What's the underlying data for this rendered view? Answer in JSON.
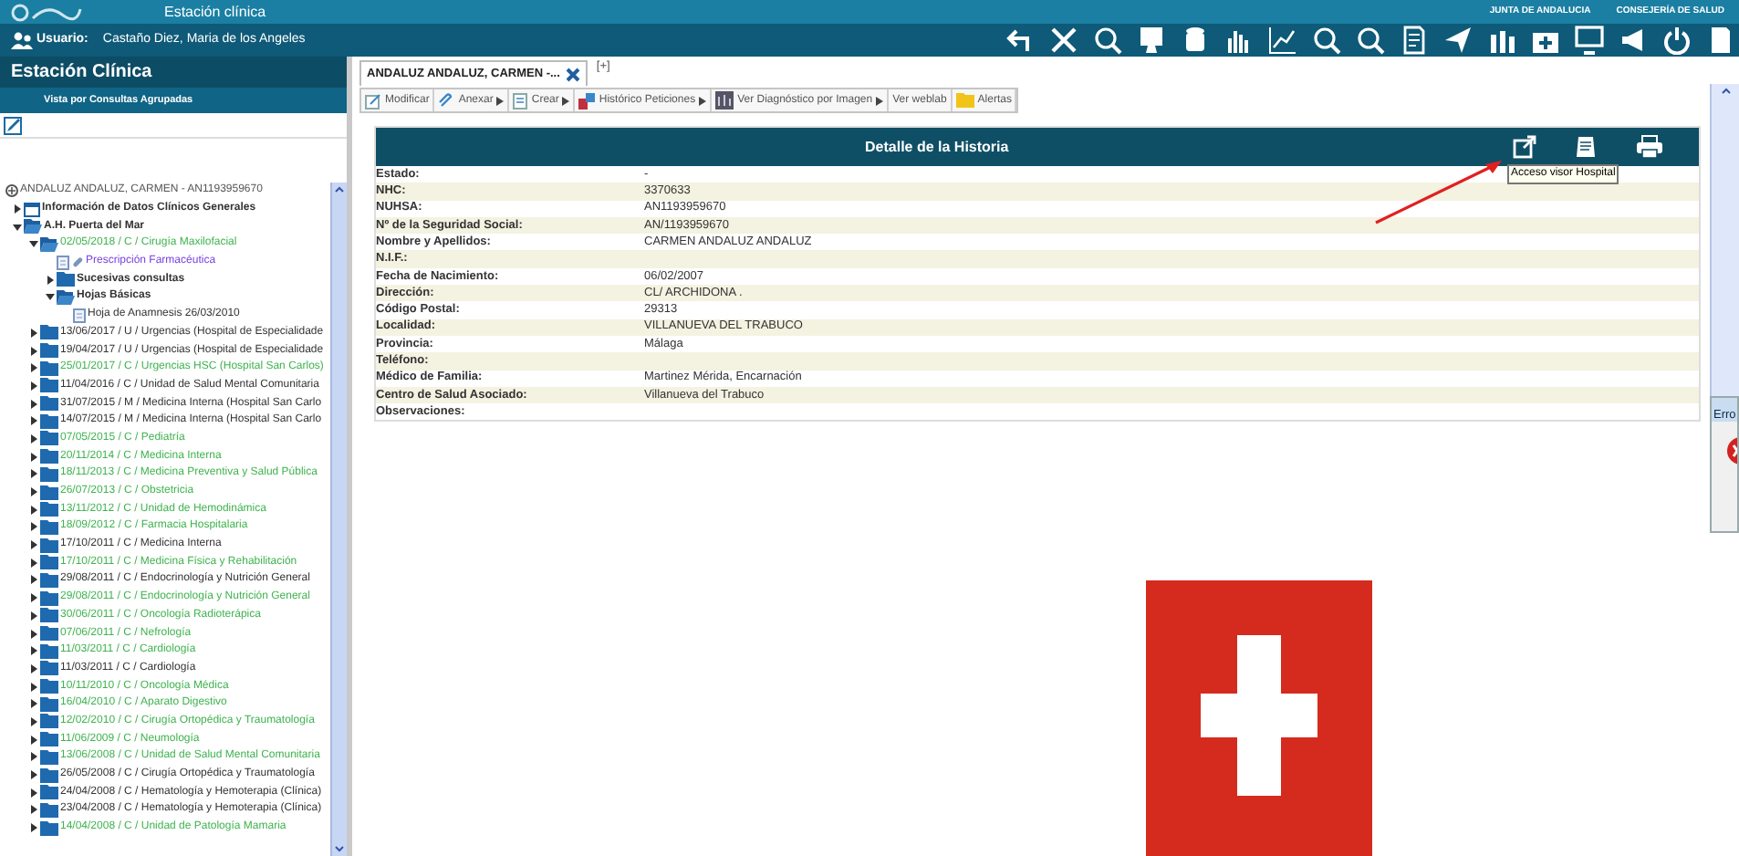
{
  "header": {
    "app_title": "Estación clínica",
    "user_label": "Usuario:",
    "user_name": "Castaño Diez, Maria de los Angeles",
    "org_top": "JUNTA DE ANDALUCIA",
    "org_bottom": "CONSEJERÍA DE SALUD"
  },
  "sidebar": {
    "title": "Estación Clínica",
    "view_label": "Vista por Consultas Agrupadas",
    "tree": {
      "label": "ANDALUZ ANDALUZ, CARMEN - AN1193959670",
      "kind": "patient",
      "children": [
        {
          "label": "Información de Datos Clínicos Generales",
          "kind": "info",
          "expanded": false
        },
        {
          "label": "A.H. Puerta del Mar",
          "kind": "group",
          "expanded": true,
          "children": [
            {
              "label": "02/05/2018 / C / Cirugía Maxilofacial",
              "kind": "visit",
              "color": "#3fb34f",
              "expanded": true,
              "children": [
                {
                  "label": "Prescripción Farmacéutica",
                  "kind": "prescription"
                },
                {
                  "label": "Sucesivas consultas",
                  "kind": "group",
                  "expanded": false
                },
                {
                  "label": "Hojas Básicas",
                  "kind": "group",
                  "expanded": true,
                  "children": [
                    {
                      "label": "Hoja de Anamnesis 26/03/2010",
                      "kind": "doc"
                    }
                  ]
                }
              ]
            },
            {
              "label": "13/06/2017 / U / Urgencias (Hospital de Especialidade",
              "kind": "visit",
              "color": "#333333",
              "expanded": false
            },
            {
              "label": "19/04/2017 / U / Urgencias (Hospital de Especialidade",
              "kind": "visit",
              "color": "#333333",
              "expanded": false
            },
            {
              "label": "25/01/2017 / C / Urgencias HSC (Hospital San Carlos)",
              "kind": "visit",
              "color": "#3fb34f",
              "expanded": false
            },
            {
              "label": "11/04/2016 / C / Unidad de Salud Mental Comunitaria",
              "kind": "visit",
              "color": "#333333",
              "expanded": false
            },
            {
              "label": "31/07/2015 / M / Medicina Interna (Hospital San Carlo",
              "kind": "visit",
              "color": "#333333",
              "expanded": false
            },
            {
              "label": "14/07/2015 / M / Medicina Interna (Hospital San Carlo",
              "kind": "visit",
              "color": "#333333",
              "expanded": false
            },
            {
              "label": "07/05/2015 / C / Pediatría",
              "kind": "visit",
              "color": "#3fb34f",
              "expanded": false
            },
            {
              "label": "20/11/2014 / C / Medicina Interna",
              "kind": "visit",
              "color": "#3fb34f",
              "expanded": false
            },
            {
              "label": "18/11/2013 / C / Medicina Preventiva y Salud Pública",
              "kind": "visit",
              "color": "#3fb34f",
              "expanded": false
            },
            {
              "label": "26/07/2013 / C / Obstetricia",
              "kind": "visit",
              "color": "#3fb34f",
              "expanded": false
            },
            {
              "label": "13/11/2012 / C / Unidad de Hemodinámica",
              "kind": "visit",
              "color": "#3fb34f",
              "expanded": false
            },
            {
              "label": "18/09/2012 / C / Farmacia Hospitalaria",
              "kind": "visit",
              "color": "#3fb34f",
              "expanded": false
            },
            {
              "label": "17/10/2011 / C / Medicina Interna",
              "kind": "visit",
              "color": "#333333",
              "expanded": false
            },
            {
              "label": "17/10/2011 / C / Medicina Física y Rehabilitación",
              "kind": "visit",
              "color": "#3fb34f",
              "expanded": false
            },
            {
              "label": "29/08/2011 / C / Endocrinología y Nutrición General",
              "kind": "visit",
              "color": "#333333",
              "expanded": false
            },
            {
              "label": "29/08/2011 / C / Endocrinología y Nutrición General",
              "kind": "visit",
              "color": "#3fb34f",
              "expanded": false
            },
            {
              "label": "30/06/2011 / C / Oncología Radioterápica",
              "kind": "visit",
              "color": "#3fb34f",
              "expanded": false
            },
            {
              "label": "07/06/2011 / C / Nefrología",
              "kind": "visit",
              "color": "#3fb34f",
              "expanded": false
            },
            {
              "label": "11/03/2011 / C / Cardiología",
              "kind": "visit",
              "color": "#3fb34f",
              "expanded": false
            },
            {
              "label": "11/03/2011 / C / Cardiología",
              "kind": "visit",
              "color": "#333333",
              "expanded": false
            },
            {
              "label": "10/11/2010 / C / Oncología Médica",
              "kind": "visit",
              "color": "#3fb34f",
              "expanded": false
            },
            {
              "label": "16/04/2010 / C / Aparato Digestivo",
              "kind": "visit",
              "color": "#3fb34f",
              "expanded": false
            },
            {
              "label": "12/02/2010 / C / Cirugía Ortopédica y Traumatología",
              "kind": "visit",
              "color": "#3fb34f",
              "expanded": false
            },
            {
              "label": "11/06/2009 / C / Neumología",
              "kind": "visit",
              "color": "#3fb34f",
              "expanded": false
            },
            {
              "label": "13/06/2008 / C / Unidad de Salud Mental Comunitaria",
              "kind": "visit",
              "color": "#3fb34f",
              "expanded": false
            },
            {
              "label": "26/05/2008 / C / Cirugía Ortopédica y Traumatología",
              "kind": "visit",
              "color": "#333333",
              "expanded": false
            },
            {
              "label": "24/04/2008 / C / Hematología y Hemoterapia (Clínica)",
              "kind": "visit",
              "color": "#333333",
              "expanded": false
            },
            {
              "label": "23/04/2008 / C / Hematología y Hemoterapia (Clínica)",
              "kind": "visit",
              "color": "#333333",
              "expanded": false
            },
            {
              "label": "14/04/2008 / C / Unidad de Patología Mamaria",
              "kind": "visit",
              "color": "#3fb34f",
              "expanded": false
            }
          ]
        }
      ]
    }
  },
  "tabs": [
    {
      "label": "ANDALUZ ANDALUZ, CARMEN -...",
      "selected": true
    },
    {
      "label": "[+]",
      "selected": false
    }
  ],
  "toolbar": [
    {
      "label": "Modificar",
      "submenu": false
    },
    {
      "label": "Anexar",
      "submenu": true
    },
    {
      "label": "Crear",
      "submenu": true
    },
    {
      "label": "Histórico Peticiones",
      "submenu": true
    },
    {
      "label": "Ver Diagnóstico por Imagen",
      "submenu": true
    },
    {
      "label": "Ver weblab",
      "submenu": false
    },
    {
      "label": "Alertas",
      "submenu": false
    }
  ],
  "detail": {
    "title": "Detalle de la Historia",
    "tooltip": "Acceso visor Hospital",
    "rows": [
      {
        "label": "Estado:",
        "value": "-"
      },
      {
        "label": "NHC:",
        "value": "3370633"
      },
      {
        "label": "NUHSA:",
        "value": "AN1193959670"
      },
      {
        "label": "Nº de la Seguridad Social:",
        "value": "AN/1193959670"
      },
      {
        "label": "Nombre y Apellidos:",
        "value": "CARMEN ANDALUZ ANDALUZ"
      },
      {
        "label": "N.I.F.:"
      },
      {
        "label": "Fecha de Nacimiento:",
        "value": "06/02/2007"
      },
      {
        "label": "Dirección:",
        "value": "CL/ ARCHIDONA ."
      },
      {
        "label": "Código Postal:",
        "value": "29313"
      },
      {
        "label": "Localidad:",
        "value": "VILLANUEVA DEL TRABUCO"
      },
      {
        "label": "Provincia:",
        "value": "Málaga"
      },
      {
        "label": "Teléfono:"
      },
      {
        "label": "Médico de Familia:",
        "value": "Martinez Mérida, Encarnación"
      },
      {
        "label": "Centro de Salud Asociado:",
        "value": "Villanueva del Trabuco"
      },
      {
        "label": "Observaciones:"
      }
    ]
  },
  "error_dialog": {
    "title": "Erro"
  }
}
